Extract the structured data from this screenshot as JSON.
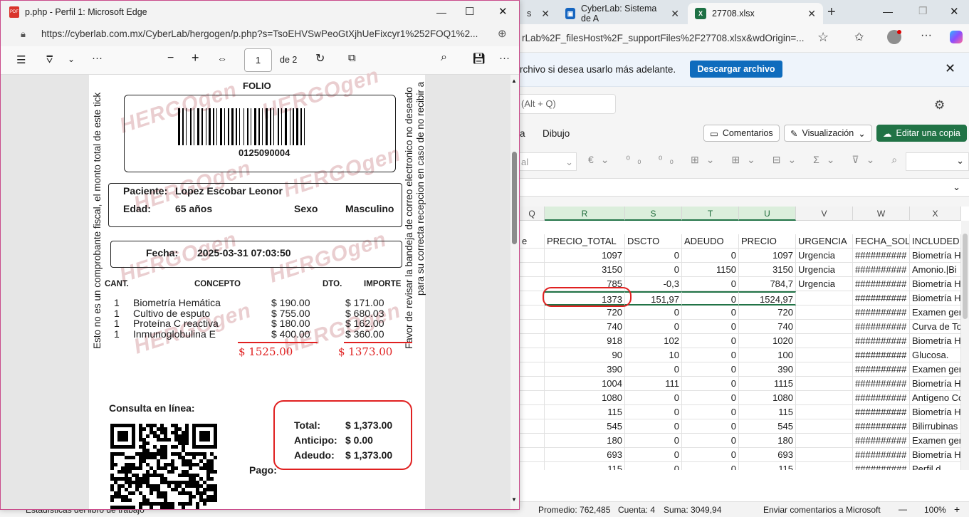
{
  "tabs": [
    {
      "label": "s"
    },
    {
      "label": "CyberLab: Sistema de A"
    },
    {
      "label": "27708.xlsx"
    }
  ],
  "excel": {
    "address": "rLab%2F_filesHost%2F_supportFiles%2F27708.xlsx&wdOrigin=...",
    "info_text": "rchivo si desea usarlo más adelante.",
    "download_button": "Descargar archivo",
    "search_hint": "(Alt + Q)",
    "menu": [
      "a",
      "Dibujo"
    ],
    "comments_button": "Comentarios",
    "view_button": "Visualización",
    "edit_button": "Editar una copia",
    "font_box": "al",
    "columns": [
      {
        "letter": "Q",
        "header": "e"
      },
      {
        "letter": "R",
        "header": "PRECIO_TOTAL"
      },
      {
        "letter": "S",
        "header": "DSCTO"
      },
      {
        "letter": "T",
        "header": "ADEUDO"
      },
      {
        "letter": "U",
        "header": "PRECIO"
      },
      {
        "letter": "V",
        "header": "URGENCIA"
      },
      {
        "letter": "W",
        "header": "FECHA_SOLIC"
      },
      {
        "letter": "X",
        "header": "INCLUDED"
      }
    ],
    "rows": [
      [
        "1097",
        "0",
        "0",
        "1097",
        "Urgencia",
        "##########",
        "Biometría H"
      ],
      [
        "3150",
        "0",
        "1150",
        "3150",
        "Urgencia",
        "##########",
        "Amonio.|Bi"
      ],
      [
        "785",
        "-0,3",
        "0",
        "784,7",
        "Urgencia",
        "##########",
        "Biometría H"
      ],
      [
        "1373",
        "151,97",
        "0",
        "1524,97",
        "",
        "##########",
        "Biometría H"
      ],
      [
        "720",
        "0",
        "0",
        "720",
        "",
        "##########",
        "Examen ger"
      ],
      [
        "740",
        "0",
        "0",
        "740",
        "",
        "##########",
        "Curva de To"
      ],
      [
        "918",
        "102",
        "0",
        "1020",
        "",
        "##########",
        "Biometría H"
      ],
      [
        "90",
        "10",
        "0",
        "100",
        "",
        "##########",
        "Glucosa."
      ],
      [
        "390",
        "0",
        "0",
        "390",
        "",
        "##########",
        "Examen ger"
      ],
      [
        "1004",
        "111",
        "0",
        "1115",
        "",
        "##########",
        "Biometría H"
      ],
      [
        "1080",
        "0",
        "0",
        "1080",
        "",
        "##########",
        "Antígeno Co"
      ],
      [
        "115",
        "0",
        "0",
        "115",
        "",
        "##########",
        "Biometría H"
      ],
      [
        "545",
        "0",
        "0",
        "545",
        "",
        "##########",
        "Bilirrubinas"
      ],
      [
        "180",
        "0",
        "0",
        "180",
        "",
        "##########",
        "Examen ger"
      ],
      [
        "693",
        "0",
        "0",
        "693",
        "",
        "##########",
        "Biometría H"
      ],
      [
        "115",
        "0",
        "0",
        "115",
        "",
        "##########",
        "Perfil d"
      ]
    ],
    "status": {
      "left": "Estadísticas del libro de trabajo",
      "avg": "Promedio: 762,485",
      "count": "Cuenta: 4",
      "sum": "Suma: 3049,94",
      "feedback": "Enviar comentarios a Microsoft",
      "zoom": "100%"
    }
  },
  "pdf": {
    "title": "p.php - Perfil 1: Microsoft Edge",
    "url": "https://cyberlab.com.mx/CyberLab/hergogen/p.php?s=TsoEHVSwPeoGtXjhUeFixcyr1%252FOQ1%2...",
    "page_input": "1",
    "page_total": "de 2",
    "ticket": {
      "folio_label": "FOLIO",
      "barcode": "0125090004",
      "paciente_label": "Paciente:",
      "paciente": "Lopez Escobar Leonor",
      "edad_label": "Edad:",
      "edad": "65 años",
      "sexo_label": "Sexo",
      "sexo": "Masculino",
      "fecha_label": "Fecha:",
      "fecha": "2025-03-31 07:03:50",
      "headers": [
        "CANT.",
        "CONCEPTO",
        "DTO.",
        "IMPORTE"
      ],
      "items": [
        {
          "cant": "1",
          "concepto": "Biometría Hemática",
          "precio": "$ 190.00",
          "importe": "$ 171.00"
        },
        {
          "cant": "1",
          "concepto": "Cultivo de esputo",
          "precio": "$ 755.00",
          "importe": "$ 680.03"
        },
        {
          "cant": "1",
          "concepto": "Proteína C reactiva",
          "precio": "$ 180.00",
          "importe": "$ 162.00"
        },
        {
          "cant": "1",
          "concepto": "Inmunoglobulina E",
          "precio": "$ 400.00",
          "importe": "$ 360.00"
        }
      ],
      "hand_total_precio": "$ 1525.00",
      "hand_total_importe": "$ 1373.00",
      "consulta": "Consulta en línea:",
      "total_label": "Total:",
      "total": "$ 1,373.00",
      "anticipo_label": "Anticipo:",
      "anticipo": "$ 0.00",
      "adeudo_label": "Adeudo:",
      "adeudo": "$ 1,373.00",
      "pago_label": "Pago:",
      "left_vertical": "Esto no es un comprobante fiscal, el monto total de este tick",
      "right_vertical_1": "Favor de revisar la bandeja de correo electronico no deseado",
      "right_vertical_2": "para su correcta recepcion en caso de no recibir a",
      "watermark": "HERGOgen"
    }
  }
}
